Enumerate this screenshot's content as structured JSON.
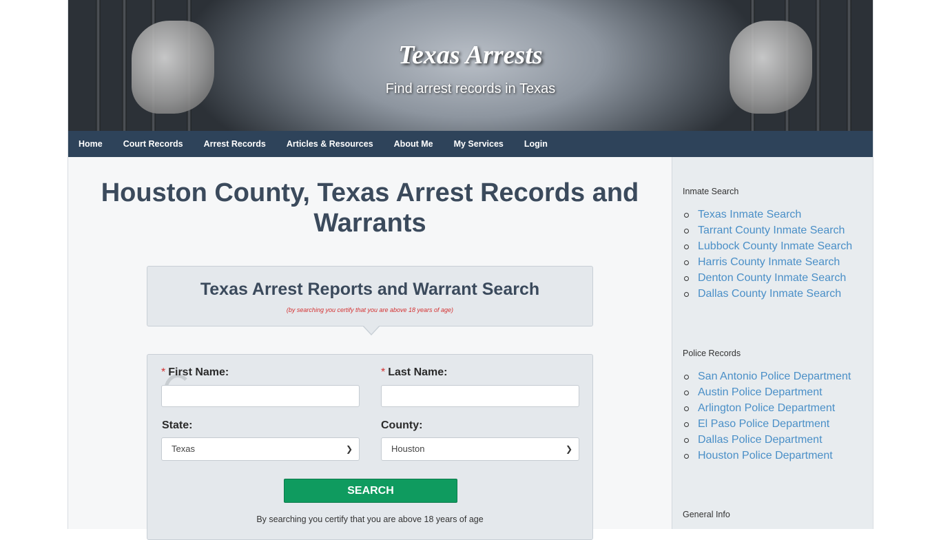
{
  "header": {
    "title": "Texas Arrests",
    "subtitle": "Find arrest records in Texas"
  },
  "nav": {
    "items": [
      "Home",
      "Court Records",
      "Arrest Records",
      "Articles & Resources",
      "About Me",
      "My Services",
      "Login"
    ]
  },
  "main": {
    "page_title": "Houston County, Texas Arrest Records and Warrants",
    "search_title": "Texas Arrest Reports and Warrant Search",
    "search_note": "(by searching you certify that you are above 18 years of age)",
    "form": {
      "required_mark": "*",
      "first_name_label": "First Name:",
      "last_name_label": "Last Name:",
      "state_label": "State:",
      "county_label": "County:",
      "state_value": "Texas",
      "county_value": "Houston",
      "search_button": "SEARCH",
      "certify_text": "By searching you certify that you are above 18 years of age"
    }
  },
  "sidebar": {
    "sections": [
      {
        "heading": "Inmate Search",
        "links": [
          "Texas Inmate Search",
          "Tarrant County Inmate Search",
          "Lubbock County Inmate Search",
          "Harris County Inmate Search",
          "Denton County Inmate Search",
          "Dallas County Inmate Search"
        ]
      },
      {
        "heading": "Police Records",
        "links": [
          "San Antonio Police Department",
          "Austin Police Department",
          "Arlington Police Department",
          "El Paso Police Department",
          "Dallas Police Department",
          "Houston Police Department"
        ]
      },
      {
        "heading": "General Info",
        "links": []
      }
    ]
  },
  "icons": {
    "select_chevron": "chevron-down-icon",
    "loading": "loading-spinner-icon"
  },
  "colors": {
    "nav_bg": "#2e435a",
    "button_bg": "#0f9b5f",
    "link": "#4a8fc7",
    "required": "#d43030"
  }
}
